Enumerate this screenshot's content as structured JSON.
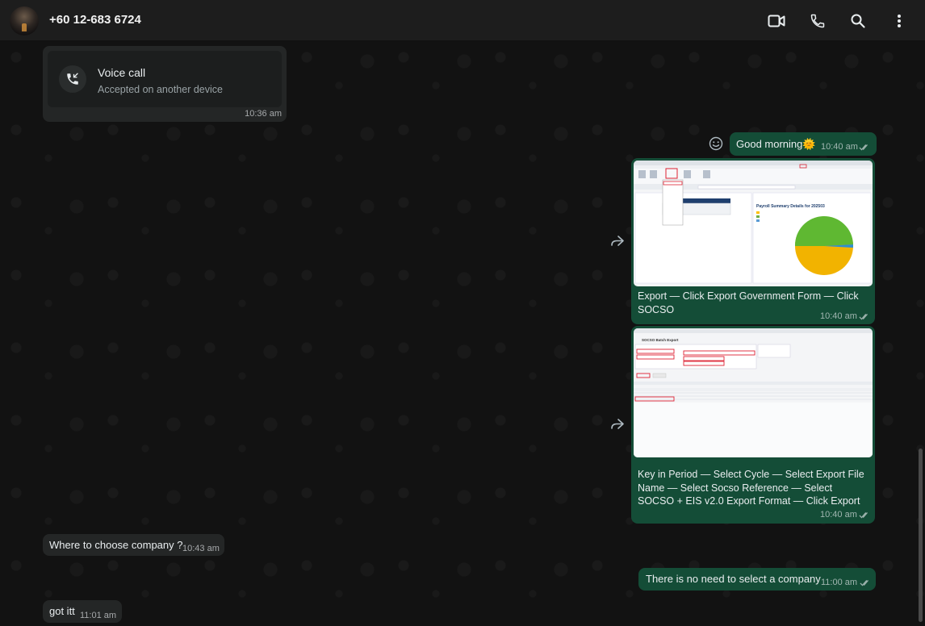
{
  "header": {
    "contact_name": "+60 12-683 6724",
    "icons": [
      "video-call-icon",
      "phone-icon",
      "search-icon",
      "more-menu-icon"
    ]
  },
  "messages": {
    "voice_call": {
      "title": "Voice call",
      "subtitle": "Accepted on another device",
      "time": "10:36 am"
    },
    "good_morning": {
      "text": "Good morning",
      "emoji": "🌞",
      "time": "10:40 am"
    },
    "image1": {
      "caption": "Export — Click Export Government Form — Click SOCSO",
      "time": "10:40 am",
      "screenshot_title": "Payroll Summary Details for 202503"
    },
    "image2": {
      "caption": "Key in Period — Select Cycle — Select Export File Name — Select Socso Reference — Select SOCSO + EIS v2.0 Export Format — Click Export",
      "time": "10:40 am",
      "screenshot_title": "SOCSO Batch Export"
    },
    "where_company": {
      "text": "Where to choose company ?",
      "time": "10:43 am"
    },
    "no_need": {
      "text": "There is no need to select a company",
      "time": "11:00 am"
    },
    "got_itt": {
      "text": "got itt",
      "time": "11:01 am"
    }
  },
  "colors": {
    "outgoing_bubble": "#144d37",
    "incoming_bubble": "#242626",
    "header_bg": "#1d1d1d",
    "chat_bg": "#121212"
  }
}
